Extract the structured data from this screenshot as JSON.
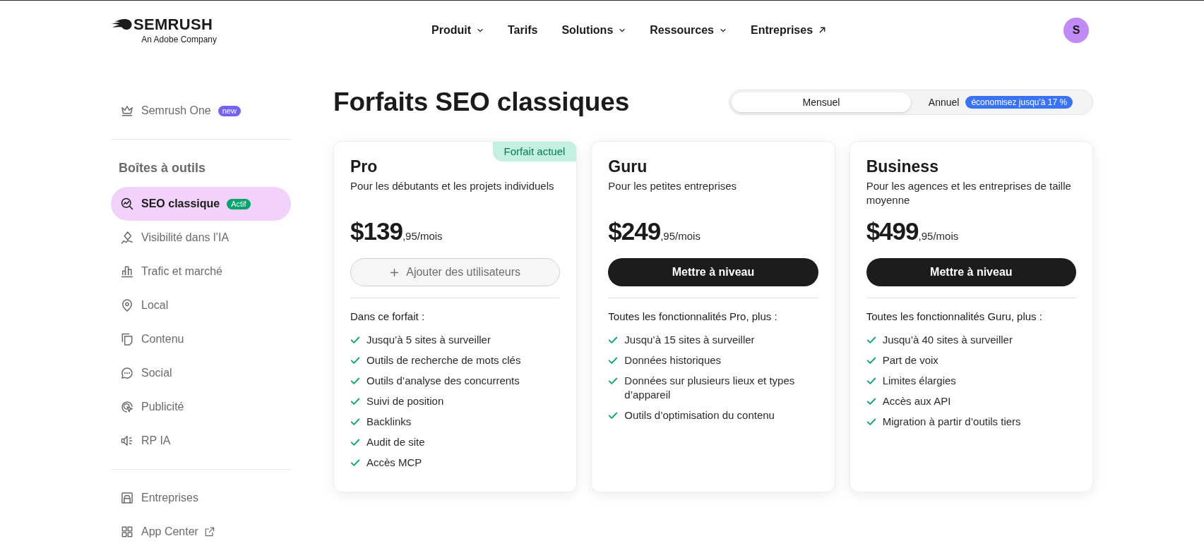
{
  "header": {
    "logo": {
      "wordmark": "SEMRUSH",
      "tagline": "An Adobe Company"
    },
    "nav": [
      {
        "label": "Produit",
        "kind": "dropdown"
      },
      {
        "label": "Tarifs",
        "kind": "link"
      },
      {
        "label": "Solutions",
        "kind": "dropdown"
      },
      {
        "label": "Ressources",
        "kind": "dropdown"
      },
      {
        "label": "Entreprises",
        "kind": "external"
      }
    ],
    "avatar": {
      "initial": "S"
    }
  },
  "sidebar": {
    "sections": [
      {
        "items": [
          {
            "label": "Semrush One",
            "selected": false,
            "badge": {
              "text": "new",
              "color": "#7462f4"
            }
          }
        ]
      },
      {
        "heading": "Boîtes à outils",
        "items": [
          {
            "label": "SEO classique",
            "selected": true,
            "badge": {
              "text": "Actif",
              "color": "#05a46c"
            }
          },
          {
            "label": "Visibilité dans l’IA",
            "selected": false
          },
          {
            "label": "Trafic et marché",
            "selected": false
          },
          {
            "label": "Local",
            "selected": false
          },
          {
            "label": "Contenu",
            "selected": false
          },
          {
            "label": "Social",
            "selected": false
          },
          {
            "label": "Publicité",
            "selected": false
          },
          {
            "label": "RP IA",
            "selected": false
          }
        ]
      },
      {
        "items": [
          {
            "label": "Entreprises",
            "selected": false
          },
          {
            "label": "App Center",
            "selected": false,
            "external": true
          }
        ]
      }
    ]
  },
  "main": {
    "title": "Forfaits SEO classiques",
    "billing_toggle": {
      "options": [
        {
          "label": "Mensuel",
          "selected": true
        },
        {
          "label": "Annuel",
          "selected": false,
          "badge": "économisez jusqu'à 17 %"
        }
      ]
    },
    "plans": [
      {
        "name": "Pro",
        "description": "Pour les débutants et les projets individuels",
        "price": "$139",
        "price_suffix": ",95/mois",
        "badge": "Forfait actuel",
        "button": {
          "label": "Ajouter des utilisateurs",
          "kind": "add"
        },
        "features_heading": "Dans ce forfait :",
        "features": [
          "Jusqu’à 5 sites à surveiller",
          "Outils de recherche de mots clés",
          "Outils d’analyse des concurrents",
          "Suivi de position",
          "Backlinks",
          "Audit de site",
          "Accès MCP"
        ]
      },
      {
        "name": "Guru",
        "description": "Pour les petites entreprises",
        "price": "$249",
        "price_suffix": ",95/mois",
        "button": {
          "label": "Mettre à niveau",
          "kind": "primary"
        },
        "features_heading": "Toutes les fonctionnalités Pro, plus :",
        "features": [
          "Jusqu’à 15 sites à surveiller",
          "Données historiques",
          "Données sur plusieurs lieux et types d’appareil",
          "Outils d’optimisation du contenu"
        ]
      },
      {
        "name": "Business",
        "description": "Pour les agences et les entreprises de taille moyenne",
        "price": "$499",
        "price_suffix": ",95/mois",
        "button": {
          "label": "Mettre à niveau",
          "kind": "primary"
        },
        "features_heading": "Toutes les fonctionnalités Guru, plus :",
        "features": [
          "Jusqu’à 40 sites à surveiller",
          "Part de voix",
          "Limites élargies",
          "Accès aux API",
          "Migration à partir d’outils tiers"
        ]
      }
    ]
  }
}
